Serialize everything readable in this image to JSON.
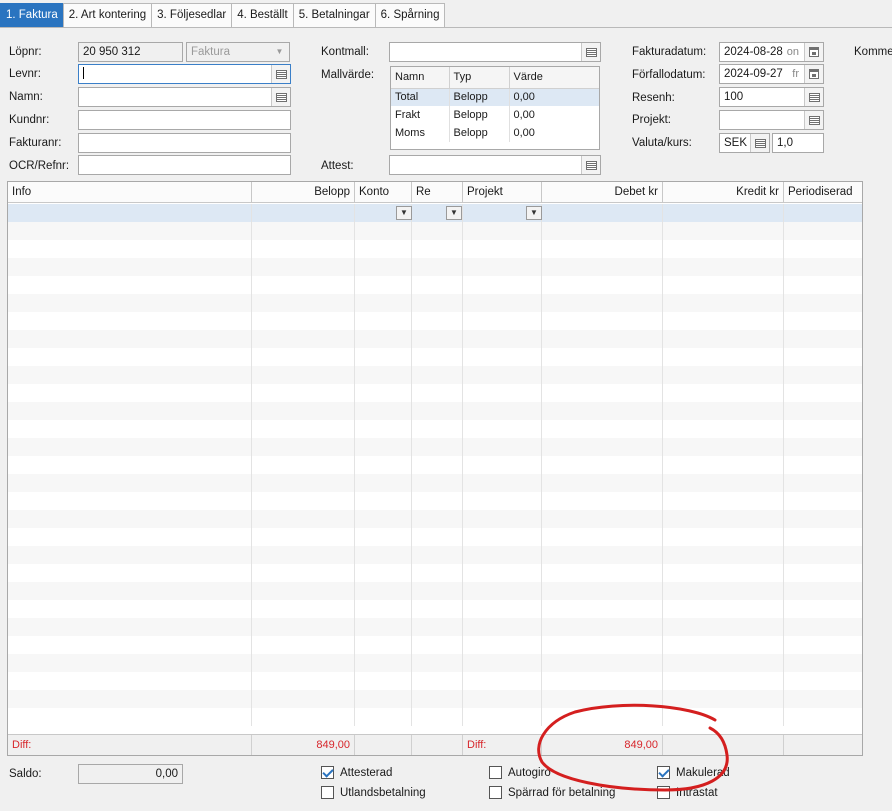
{
  "tabs": [
    "1. Faktura",
    "2. Art kontering",
    "3. Följesedlar",
    "4. Beställt",
    "5. Betalningar",
    "6. Spårning"
  ],
  "left_form": {
    "lopnr_label": "Löpnr:",
    "lopnr_value": "20 950 312",
    "type_value": "Faktura",
    "levnr_label": "Levnr:",
    "levnr_value": "",
    "namn_label": "Namn:",
    "namn_value": "",
    "kundnr_label": "Kundnr:",
    "kundnr_value": "",
    "fakturanr_label": "Fakturanr:",
    "fakturanr_value": "",
    "ocr_label": "OCR/Refnr:",
    "ocr_value": ""
  },
  "middle_form": {
    "kontmall_label": "Kontmall:",
    "kontmall_value": "",
    "mallvarde_label": "Mallvärde:",
    "attest_label": "Attest:",
    "attest_value": ""
  },
  "mallvarde_table": {
    "headers": [
      "Namn",
      "Typ",
      "Värde"
    ],
    "rows": [
      [
        "Total",
        "Belopp",
        "0,00"
      ],
      [
        "Frakt",
        "Belopp",
        "0,00"
      ],
      [
        "Moms",
        "Belopp",
        "0,00"
      ]
    ]
  },
  "right_form": {
    "fakturadatum_label": "Fakturadatum:",
    "fakturadatum_value": "2024-08-28",
    "fakturadatum_day": "on",
    "forfallodatum_label": "Förfallodatum:",
    "forfallodatum_value": "2024-09-27",
    "forfallodatum_day": "fr",
    "resenh_label": "Resenh:",
    "resenh_value": "100",
    "projekt_label": "Projekt:",
    "projekt_value": "",
    "valuta_label": "Valuta/kurs:",
    "valuta_value": "SEK",
    "kurs_value": "1,0",
    "kommentar_label": "Kommer"
  },
  "grid": {
    "columns": [
      "Info",
      "Belopp",
      "Konto",
      "Re",
      "Projekt",
      "Debet kr",
      "Kredit kr",
      "Periodiserad"
    ],
    "footer": {
      "diff_label_left": "Diff:",
      "diff_belopp": "849,00",
      "diff_label_right": "Diff:",
      "diff_debet": "849,00"
    }
  },
  "bottom": {
    "saldo_label": "Saldo:",
    "saldo_value": "0,00",
    "checkboxes": [
      {
        "label": "Attesterad",
        "checked": true
      },
      {
        "label": "Utlandsbetalning",
        "checked": false
      },
      {
        "label": "Autogiro",
        "checked": false
      },
      {
        "label": "Spärrad för betalning",
        "checked": false
      },
      {
        "label": "Makulerad",
        "checked": true
      },
      {
        "label": "Intrastat",
        "checked": false
      }
    ]
  },
  "colors": {
    "active_tab": "#2a74c0",
    "diff_text": "#d7262b",
    "annotation_circle": "#d41f1f",
    "selected_row": "#dde8f4"
  }
}
